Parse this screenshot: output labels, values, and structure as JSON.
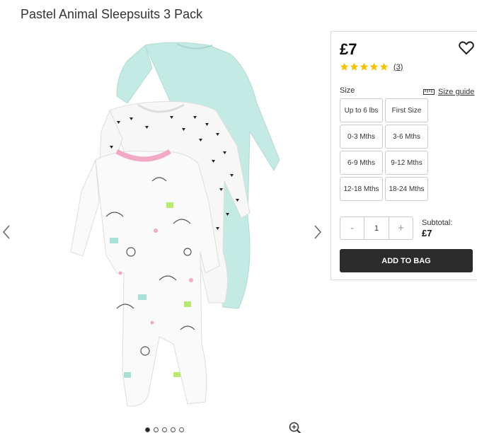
{
  "product": {
    "title": "Pastel Animal Sleepsuits 3 Pack",
    "price": "£7",
    "rating": 5,
    "review_count": "(3)"
  },
  "gallery": {
    "image_count": 5,
    "active_index": 0,
    "icons": {
      "prev": "chevron-left-icon",
      "next": "chevron-right-icon",
      "zoom": "zoom-in-icon"
    }
  },
  "size": {
    "label": "Size",
    "guide_label": "Size guide",
    "options": [
      "Up to 6 lbs",
      "First Size",
      "0-3 Mths",
      "3-6 Mths",
      "6-9 Mths",
      "9-12 Mths",
      "12-18 Mths",
      "18-24 Mths"
    ]
  },
  "quantity": {
    "minus": "-",
    "value": "1",
    "plus": "+"
  },
  "subtotal": {
    "label": "Subtotal:",
    "value": "£7"
  },
  "cart": {
    "add_label": "ADD TO BAG"
  },
  "colors": {
    "star": "#f5c400",
    "button": "#2b2b2b",
    "mint": "#bfe8e0"
  }
}
